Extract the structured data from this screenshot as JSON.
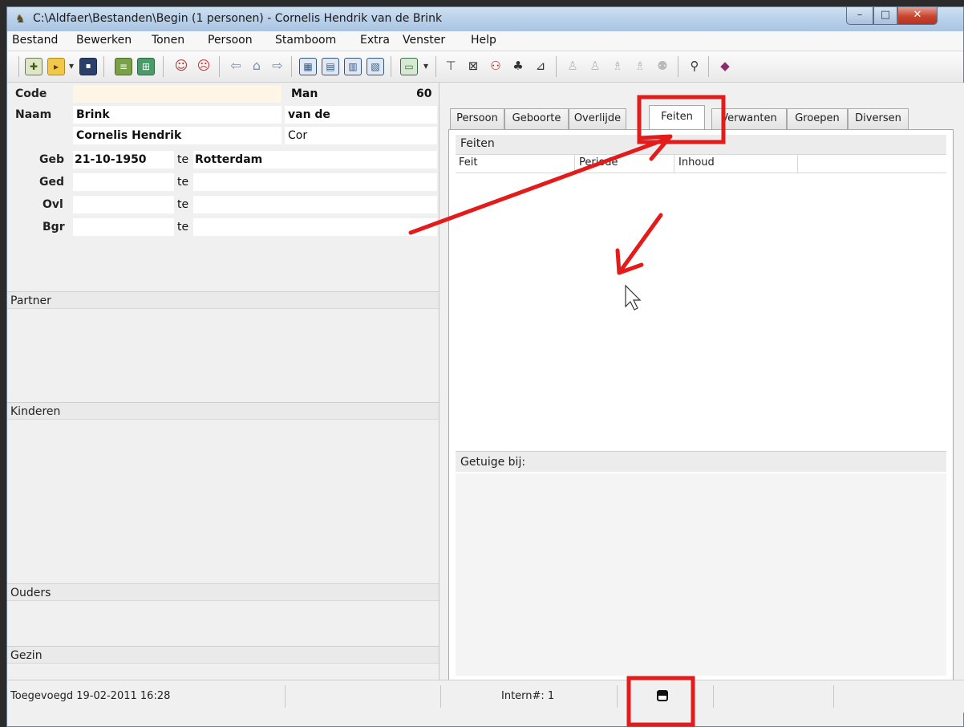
{
  "window": {
    "title": "C:\\Aldfaer\\Bestanden\\Begin (1 personen) - Cornelis Hendrik van de Brink",
    "min_label": "–",
    "max_label": "□",
    "close_label": "✕"
  },
  "menu": [
    "Bestand",
    "Bewerken",
    "Tonen",
    "Persoon",
    "Stamboom",
    "Extra",
    "Venster",
    "Help"
  ],
  "person": {
    "code_label": "Code",
    "code_value": "",
    "gender": "Man",
    "number": "60",
    "naam_label": "Naam",
    "surname": "Brink",
    "prefix": "van de",
    "firstnames": "Cornelis Hendrik",
    "nickname": "Cor",
    "geb_label": "Geb",
    "geb_date": "21-10-1950",
    "geb_te": "te",
    "geb_place": "Rotterdam",
    "ged_label": "Ged",
    "ged_te": "te",
    "ovl_label": "Ovl",
    "ovl_te": "te",
    "bgr_label": "Bgr",
    "bgr_te": "te"
  },
  "sections": {
    "partner": "Partner",
    "kinderen": "Kinderen",
    "ouders": "Ouders",
    "gezin": "Gezin"
  },
  "tabs": [
    {
      "label": "Persoon"
    },
    {
      "label": "Geboorte"
    },
    {
      "label": "Overlijde"
    },
    {
      "label": "Feiten"
    },
    {
      "label": "Verwanten"
    },
    {
      "label": "Groepen"
    },
    {
      "label": "Diversen"
    }
  ],
  "active_tab": "Feiten",
  "feiten": {
    "title": "Feiten",
    "columns": [
      "Feit",
      "Periode",
      "Inhoud"
    ],
    "getuige_label": "Getuige bij:"
  },
  "status": {
    "added": "Toegevoegd 19-02-2011 16:28",
    "intern": "Intern#: 1",
    "icon": "record-icon"
  },
  "annotation_color": "#e41b1b"
}
